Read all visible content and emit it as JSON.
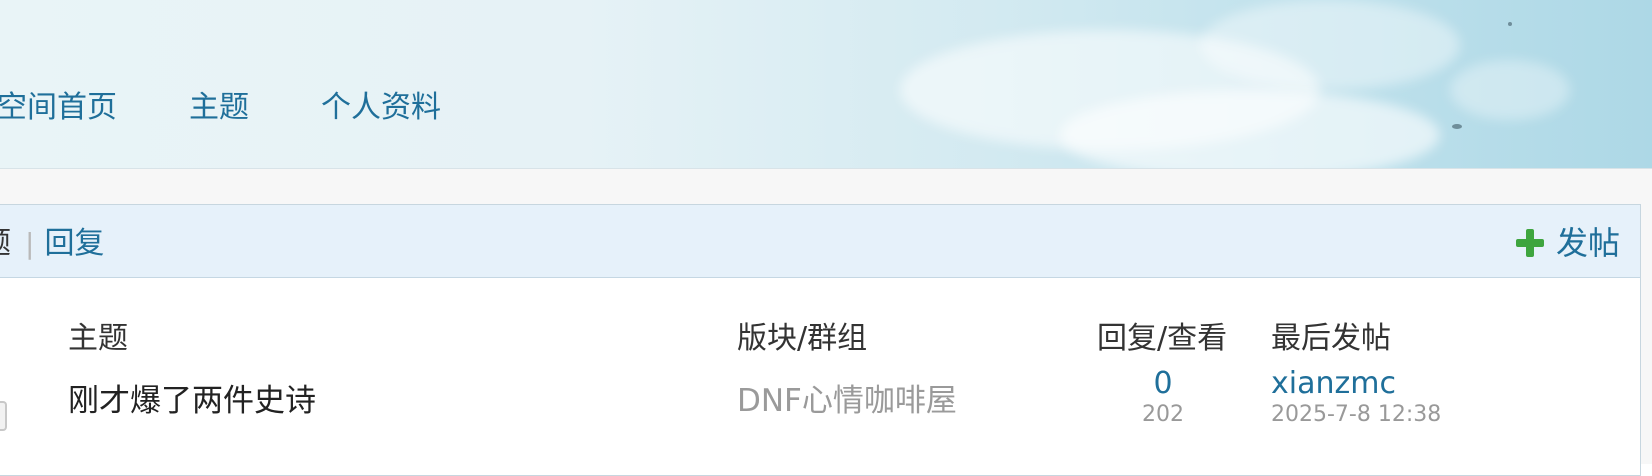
{
  "nav": {
    "items": [
      "空间首页",
      "主题",
      "个人资料"
    ]
  },
  "toolbar": {
    "tab_active": "主题",
    "tab_reply": "回复",
    "post_button": "发帖"
  },
  "table": {
    "headers": {
      "subject": "主题",
      "forum": "版块/群组",
      "replies_views": "回复/查看",
      "last_post": "最后发帖"
    },
    "rows": [
      {
        "subject": "刚才爆了两件史诗",
        "forum": "DNF心情咖啡屋",
        "replies": "0",
        "views": "202",
        "last_user": "xianzmc",
        "last_time": "2025-7-8 12:38"
      }
    ]
  },
  "colors": {
    "link": "#1f6f9a",
    "toolbar_bg": "#e6f1fa",
    "plus_icon": "#3ea53e"
  }
}
